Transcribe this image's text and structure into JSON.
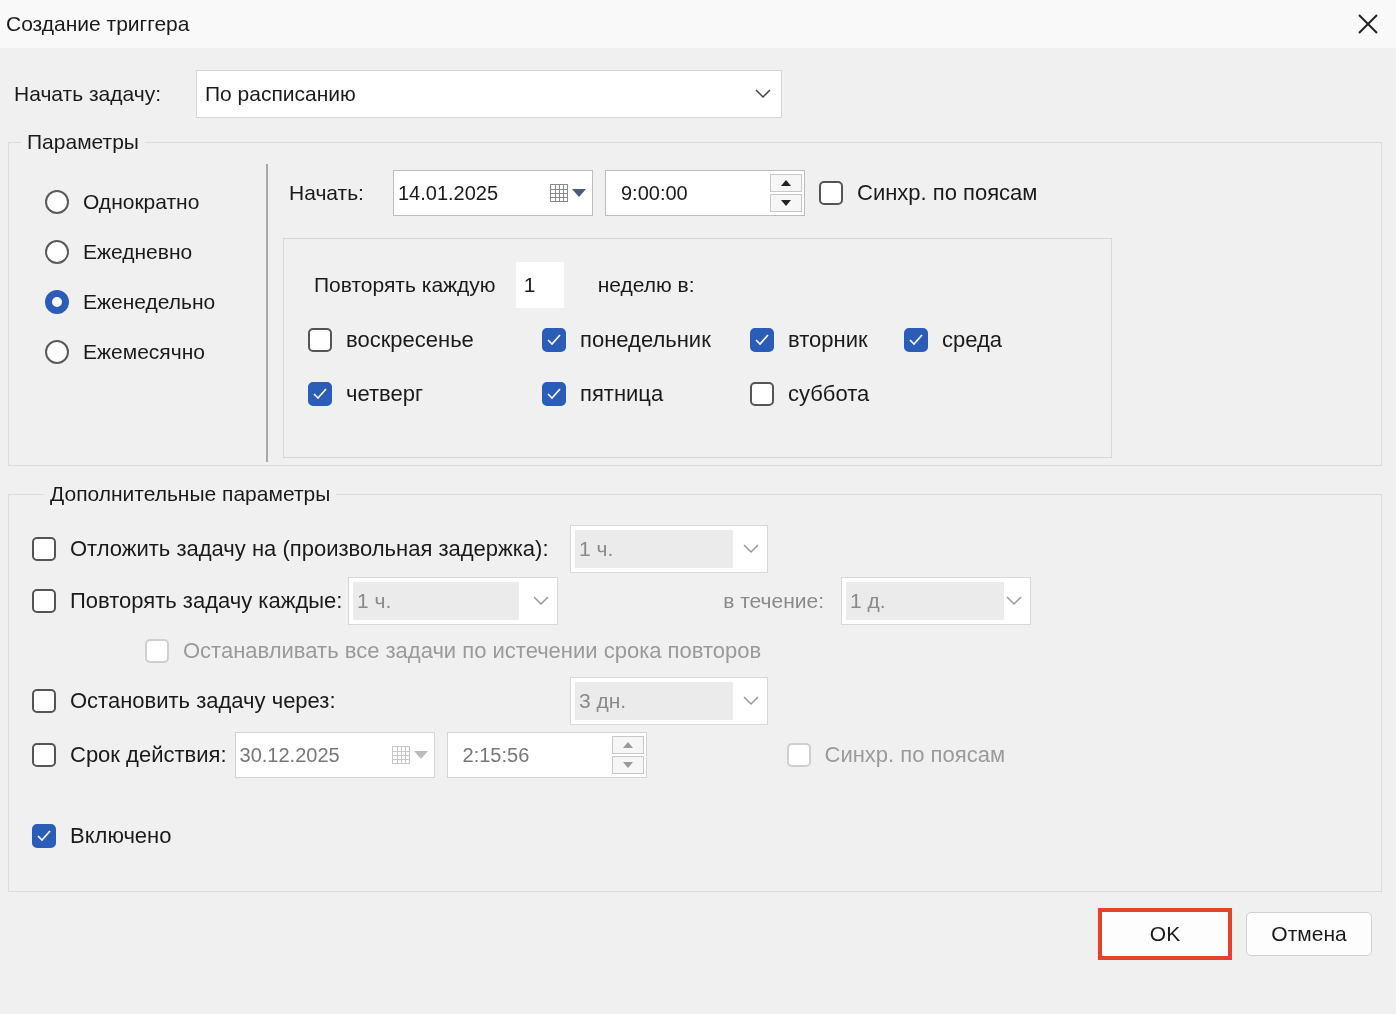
{
  "window": {
    "title": "Создание триггера"
  },
  "start_task": {
    "label": "Начать задачу:",
    "value": "По расписанию"
  },
  "parameters": {
    "title": "Параметры",
    "modes": [
      {
        "label": "Однократно",
        "selected": false
      },
      {
        "label": "Ежедневно",
        "selected": false
      },
      {
        "label": "Еженедельно",
        "selected": true
      },
      {
        "label": "Ежемесячно",
        "selected": false
      }
    ],
    "start": {
      "label": "Начать:",
      "date": "14.01.2025",
      "time": "9:00:00",
      "sync": {
        "label": "Синхр. по поясам",
        "checked": false,
        "disabled": false
      }
    },
    "recur": {
      "label": "Повторять каждую",
      "value": "1",
      "unit": "неделю в:"
    },
    "days": [
      {
        "label": "воскресенье",
        "checked": false
      },
      {
        "label": "понедельник",
        "checked": true
      },
      {
        "label": "вторник",
        "checked": true
      },
      {
        "label": "среда",
        "checked": true
      },
      {
        "label": "четверг",
        "checked": true
      },
      {
        "label": "пятница",
        "checked": true
      },
      {
        "label": "суббота",
        "checked": false
      }
    ]
  },
  "advanced": {
    "title": "Дополнительные параметры",
    "delay": {
      "label": "Отложить задачу на (произвольная задержка):",
      "checked": false,
      "value": "1 ч.",
      "disabled": true
    },
    "repeat": {
      "label": "Повторять задачу каждые:",
      "checked": false,
      "value": "1 ч.",
      "disabled": true,
      "duration_label": "в течение:",
      "duration": "1 д."
    },
    "stop_all": {
      "label": "Останавливать все задачи по истечении срока повторов",
      "checked": false,
      "disabled": true
    },
    "stop_after": {
      "label": "Остановить задачу через:",
      "checked": false,
      "value": "3 дн.",
      "disabled": true
    },
    "expire": {
      "label": "Срок действия:",
      "checked": false,
      "date": "30.12.2025",
      "time": "2:15:56",
      "disabled": true,
      "sync": {
        "label": "Синхр. по поясам",
        "checked": false,
        "disabled": true
      }
    },
    "enabled": {
      "label": "Включено",
      "checked": true
    }
  },
  "buttons": [
    {
      "label": "OK",
      "highlighted": true
    },
    {
      "label": "Отмена",
      "highlighted": false
    }
  ]
}
